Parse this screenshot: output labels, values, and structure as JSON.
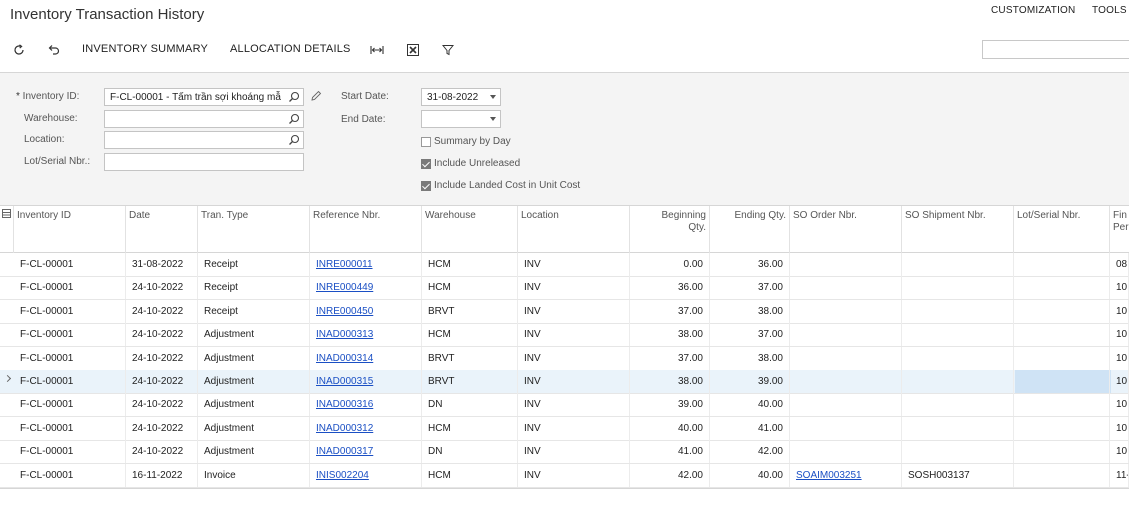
{
  "header": {
    "title": "Inventory Transaction History",
    "customization": "CUSTOMIZATION",
    "tools": "TOOLS"
  },
  "toolbar": {
    "inventory_summary": "INVENTORY SUMMARY",
    "allocation_details": "ALLOCATION DETAILS",
    "search_value": ""
  },
  "form": {
    "inventory_id_label": "Inventory ID:",
    "inventory_id_value": "F-CL-00001 - Tấm trần sợi khoáng mẫ",
    "warehouse_label": "Warehouse:",
    "warehouse_value": "",
    "location_label": "Location:",
    "location_value": "",
    "lot_serial_label": "Lot/Serial Nbr.:",
    "lot_serial_value": "",
    "start_date_label": "Start Date:",
    "start_date_value": "31-08-2022",
    "end_date_label": "End Date:",
    "end_date_value": "",
    "summary_by_day": "Summary by Day",
    "summary_by_day_checked": false,
    "include_unreleased": "Include Unreleased",
    "include_unreleased_checked": true,
    "include_landed_cost": "Include Landed Cost in Unit Cost",
    "include_landed_cost_checked": true
  },
  "grid": {
    "columns": {
      "inventory_id": "Inventory ID",
      "date": "Date",
      "tran_type": "Tran. Type",
      "reference_nbr": "Reference Nbr.",
      "warehouse": "Warehouse",
      "location": "Location",
      "beginning_qty_1": "Beginning",
      "beginning_qty_2": "Qty.",
      "ending_qty": "Ending Qty.",
      "so_order_nbr": "SO Order Nbr.",
      "so_shipment_nbr": "SO Shipment Nbr.",
      "lot_serial_nbr": "Lot/Serial Nbr.",
      "fin_period_1": "Fin",
      "fin_period_2": "Per"
    },
    "rows": [
      {
        "inventory_id": "F-CL-00001",
        "date": "31-08-2022",
        "tran_type": "Receipt",
        "reference_nbr": "INRE000011",
        "warehouse": "HCM",
        "location": "INV",
        "beginning_qty": "0.00",
        "ending_qty": "36.00",
        "so_order_nbr": "",
        "so_shipment_nbr": "",
        "lot_serial_nbr": "",
        "fin_period": "08"
      },
      {
        "inventory_id": "F-CL-00001",
        "date": "24-10-2022",
        "tran_type": "Receipt",
        "reference_nbr": "INRE000449",
        "warehouse": "HCM",
        "location": "INV",
        "beginning_qty": "36.00",
        "ending_qty": "37.00",
        "so_order_nbr": "",
        "so_shipment_nbr": "",
        "lot_serial_nbr": "",
        "fin_period": "10"
      },
      {
        "inventory_id": "F-CL-00001",
        "date": "24-10-2022",
        "tran_type": "Receipt",
        "reference_nbr": "INRE000450",
        "warehouse": "BRVT",
        "location": "INV",
        "beginning_qty": "37.00",
        "ending_qty": "38.00",
        "so_order_nbr": "",
        "so_shipment_nbr": "",
        "lot_serial_nbr": "",
        "fin_period": "10"
      },
      {
        "inventory_id": "F-CL-00001",
        "date": "24-10-2022",
        "tran_type": "Adjustment",
        "reference_nbr": "INAD000313",
        "warehouse": "HCM",
        "location": "INV",
        "beginning_qty": "38.00",
        "ending_qty": "37.00",
        "so_order_nbr": "",
        "so_shipment_nbr": "",
        "lot_serial_nbr": "",
        "fin_period": "10"
      },
      {
        "inventory_id": "F-CL-00001",
        "date": "24-10-2022",
        "tran_type": "Adjustment",
        "reference_nbr": "INAD000314",
        "warehouse": "BRVT",
        "location": "INV",
        "beginning_qty": "37.00",
        "ending_qty": "38.00",
        "so_order_nbr": "",
        "so_shipment_nbr": "",
        "lot_serial_nbr": "",
        "fin_period": "10"
      },
      {
        "inventory_id": "F-CL-00001",
        "date": "24-10-2022",
        "tran_type": "Adjustment",
        "reference_nbr": "INAD000315",
        "warehouse": "BRVT",
        "location": "INV",
        "beginning_qty": "38.00",
        "ending_qty": "39.00",
        "so_order_nbr": "",
        "so_shipment_nbr": "",
        "lot_serial_nbr": "",
        "fin_period": "10"
      },
      {
        "inventory_id": "F-CL-00001",
        "date": "24-10-2022",
        "tran_type": "Adjustment",
        "reference_nbr": "INAD000316",
        "warehouse": "DN",
        "location": "INV",
        "beginning_qty": "39.00",
        "ending_qty": "40.00",
        "so_order_nbr": "",
        "so_shipment_nbr": "",
        "lot_serial_nbr": "",
        "fin_period": "10"
      },
      {
        "inventory_id": "F-CL-00001",
        "date": "24-10-2022",
        "tran_type": "Adjustment",
        "reference_nbr": "INAD000312",
        "warehouse": "HCM",
        "location": "INV",
        "beginning_qty": "40.00",
        "ending_qty": "41.00",
        "so_order_nbr": "",
        "so_shipment_nbr": "",
        "lot_serial_nbr": "",
        "fin_period": "10"
      },
      {
        "inventory_id": "F-CL-00001",
        "date": "24-10-2022",
        "tran_type": "Adjustment",
        "reference_nbr": "INAD000317",
        "warehouse": "DN",
        "location": "INV",
        "beginning_qty": "41.00",
        "ending_qty": "42.00",
        "so_order_nbr": "",
        "so_shipment_nbr": "",
        "lot_serial_nbr": "",
        "fin_period": "10"
      },
      {
        "inventory_id": "F-CL-00001",
        "date": "16-11-2022",
        "tran_type": "Invoice",
        "reference_nbr": "INIS002204",
        "warehouse": "HCM",
        "location": "INV",
        "beginning_qty": "42.00",
        "ending_qty": "40.00",
        "so_order_nbr": "SOAIM003251",
        "so_shipment_nbr": "SOSH003137",
        "lot_serial_nbr": "",
        "fin_period": "11-"
      }
    ],
    "selected_row": 5
  },
  "icons": {
    "refresh": "refresh-icon",
    "undo": "undo-icon",
    "fit_columns": "fit-columns-icon",
    "excel": "excel-export-icon",
    "filter": "filter-icon",
    "search": "search-icon",
    "edit": "pencil-icon"
  }
}
